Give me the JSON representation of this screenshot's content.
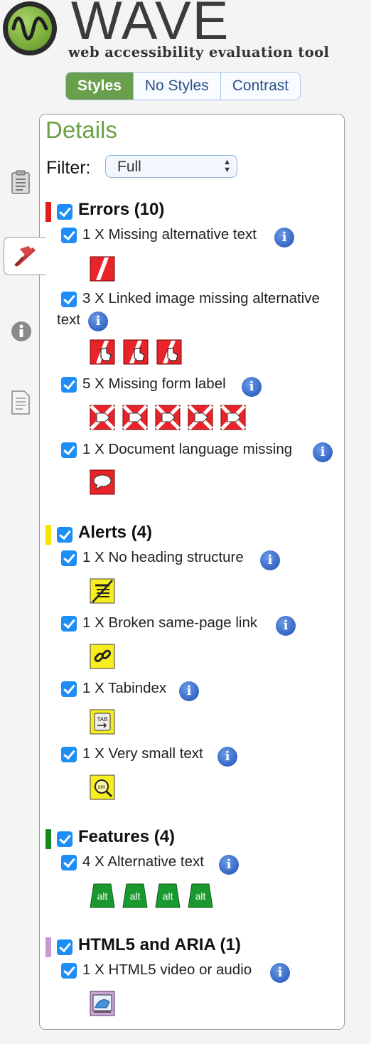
{
  "app": {
    "brand": "WAVE",
    "tagline": "web accessibility evaluation tool",
    "brand_color": "#68a043"
  },
  "view_toggle": {
    "options": [
      "Styles",
      "No Styles",
      "Contrast"
    ],
    "selected": "Styles"
  },
  "side_tabs": [
    {
      "icon": "clipboard-icon",
      "active": false
    },
    {
      "icon": "flag-icon",
      "active": true
    },
    {
      "icon": "info-icon",
      "active": false
    },
    {
      "icon": "document-icon",
      "active": false
    }
  ],
  "panel": {
    "title": "Details",
    "filter_label": "Filter:",
    "filter_value": "Full"
  },
  "categories": [
    {
      "label": "Errors (10)",
      "color": "#e21d1d",
      "checked": true,
      "items": [
        {
          "line1": "1 X Missing alternative text",
          "line2": "",
          "icon": "missing-alt-icon",
          "count": 1
        },
        {
          "line1": "3 X Linked image missing alternative",
          "line2": "text",
          "icon": "linked-image-missing-alt-icon",
          "count": 3
        },
        {
          "line1": "5 X Missing form label",
          "line2": "",
          "icon": "missing-form-label-icon",
          "count": 5
        },
        {
          "line1": "1 X Document language missing",
          "line2": "",
          "icon": "language-missing-icon",
          "count": 1
        }
      ]
    },
    {
      "label": "Alerts (4)",
      "color": "#f5e400",
      "checked": true,
      "items": [
        {
          "line1": "1 X No heading structure",
          "line2": "",
          "icon": "no-heading-icon",
          "count": 1
        },
        {
          "line1": "1 X Broken same-page link",
          "line2": "",
          "icon": "broken-link-icon",
          "count": 1
        },
        {
          "line1": "1 X Tabindex",
          "line2": "",
          "icon": "tabindex-icon",
          "count": 1
        },
        {
          "line1": "1 X Very small text",
          "line2": "",
          "icon": "small-text-icon",
          "count": 1
        }
      ]
    },
    {
      "label": "Features (4)",
      "color": "#138a1c",
      "checked": true,
      "items": [
        {
          "line1": "4 X Alternative text",
          "line2": "",
          "icon": "alt-text-icon",
          "count": 4
        }
      ]
    },
    {
      "label": "HTML5 and ARIA (1)",
      "color": "#c79ad0",
      "checked": true,
      "items": [
        {
          "line1": "1 X HTML5 video or audio",
          "line2": "",
          "icon": "html5-media-icon",
          "count": 1
        }
      ]
    }
  ],
  "icon_glyphs": {
    "missing_alt": "",
    "alt": "alt",
    "tab": "TAB",
    "small": "sm"
  }
}
